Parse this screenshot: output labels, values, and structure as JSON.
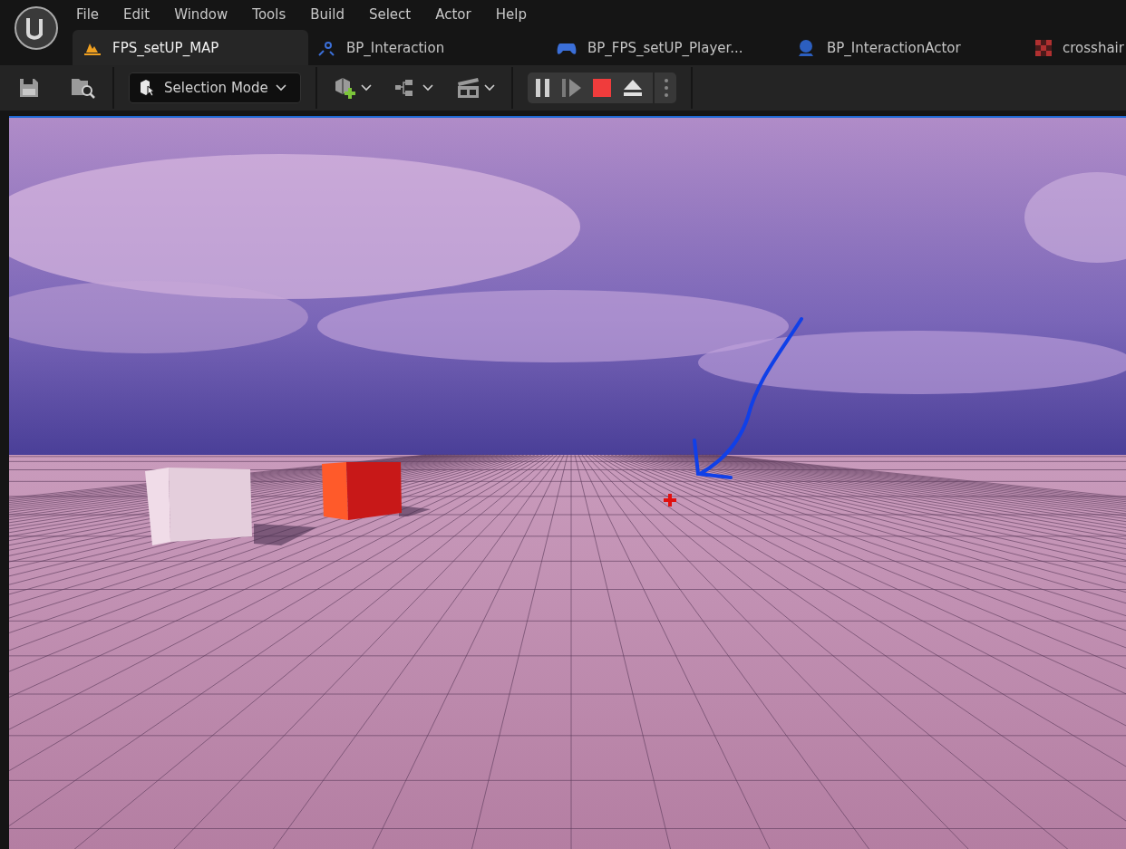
{
  "menu": [
    "File",
    "Edit",
    "Window",
    "Tools",
    "Build",
    "Select",
    "Actor",
    "Help"
  ],
  "tabs": [
    {
      "label": "FPS_setUP_MAP",
      "kind": "level",
      "selected": true
    },
    {
      "label": "BP_Interaction",
      "kind": "blueprint",
      "selected": false
    },
    {
      "label": "BP_FPS_setUP_Player...",
      "kind": "controller",
      "selected": false
    },
    {
      "label": "BP_InteractionActor",
      "kind": "actor",
      "selected": false
    },
    {
      "label": "crosshair",
      "kind": "texture",
      "selected": false
    }
  ],
  "toolbar": {
    "mode_label": "Selection Mode"
  }
}
